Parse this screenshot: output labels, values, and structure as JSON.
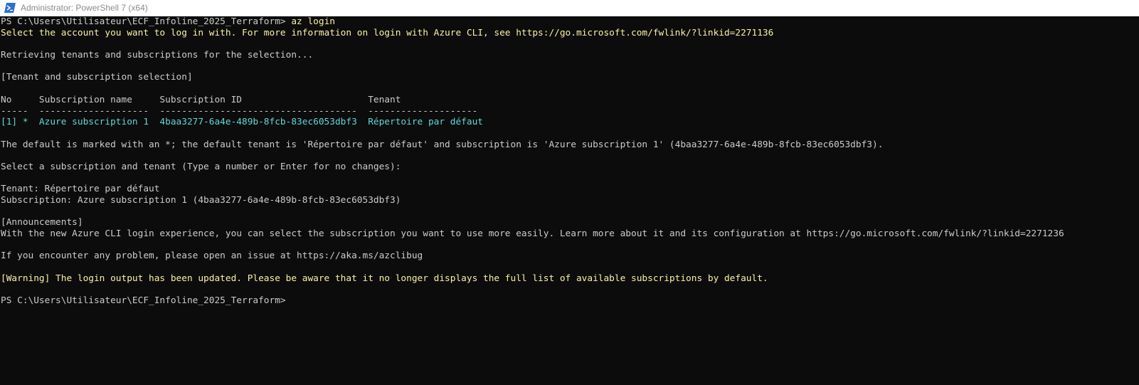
{
  "window": {
    "title": "Administrator: PowerShell 7 (x64)",
    "icon": "powershell-icon"
  },
  "colors": {
    "background": "#0c0c0c",
    "text": "#cccccc",
    "yellow": "#f9f1a5",
    "cyan": "#61d6d6"
  },
  "console": {
    "prompt1": "PS C:\\Users\\Utilisateur\\ECF_Infoline_2025_Terraform>",
    "command1": " az login",
    "select_account": "Select the account you want to log in with. For more information on login with Azure CLI, see https://go.microsoft.com/fwlink/?linkid=2271136",
    "retrieving": "Retrieving tenants and subscriptions for the selection...",
    "selection_header": "[Tenant and subscription selection]",
    "table_header": "No     Subscription name     Subscription ID                       Tenant",
    "table_rule": "-----  --------------------  ------------------------------------  --------------------",
    "table_row": "[1] *  Azure subscription 1  4baa3277-6a4e-489b-8fcb-83ec6053dbf3  Répertoire par défaut",
    "default_note": "The default is marked with an *; the default tenant is 'Répertoire par défaut' and subscription is 'Azure subscription 1' (4baa3277-6a4e-489b-8fcb-83ec6053dbf3).",
    "select_prompt": "Select a subscription and tenant (Type a number or Enter for no changes):",
    "tenant_line": "Tenant: Répertoire par défaut",
    "subscription_line": "Subscription: Azure subscription 1 (4baa3277-6a4e-489b-8fcb-83ec6053dbf3)",
    "announcements_header": "[Announcements]",
    "announcement_text": "With the new Azure CLI login experience, you can select the subscription you want to use more easily. Learn more about it and its configuration at https://go.microsoft.com/fwlink/?linkid=2271236",
    "problem_line": "If you encounter any problem, please open an issue at https://aka.ms/azclibug",
    "warning_line": "[Warning] The login output has been updated. Please be aware that it no longer displays the full list of available subscriptions by default.",
    "prompt2": "PS C:\\Users\\Utilisateur\\ECF_Infoline_2025_Terraform>"
  }
}
